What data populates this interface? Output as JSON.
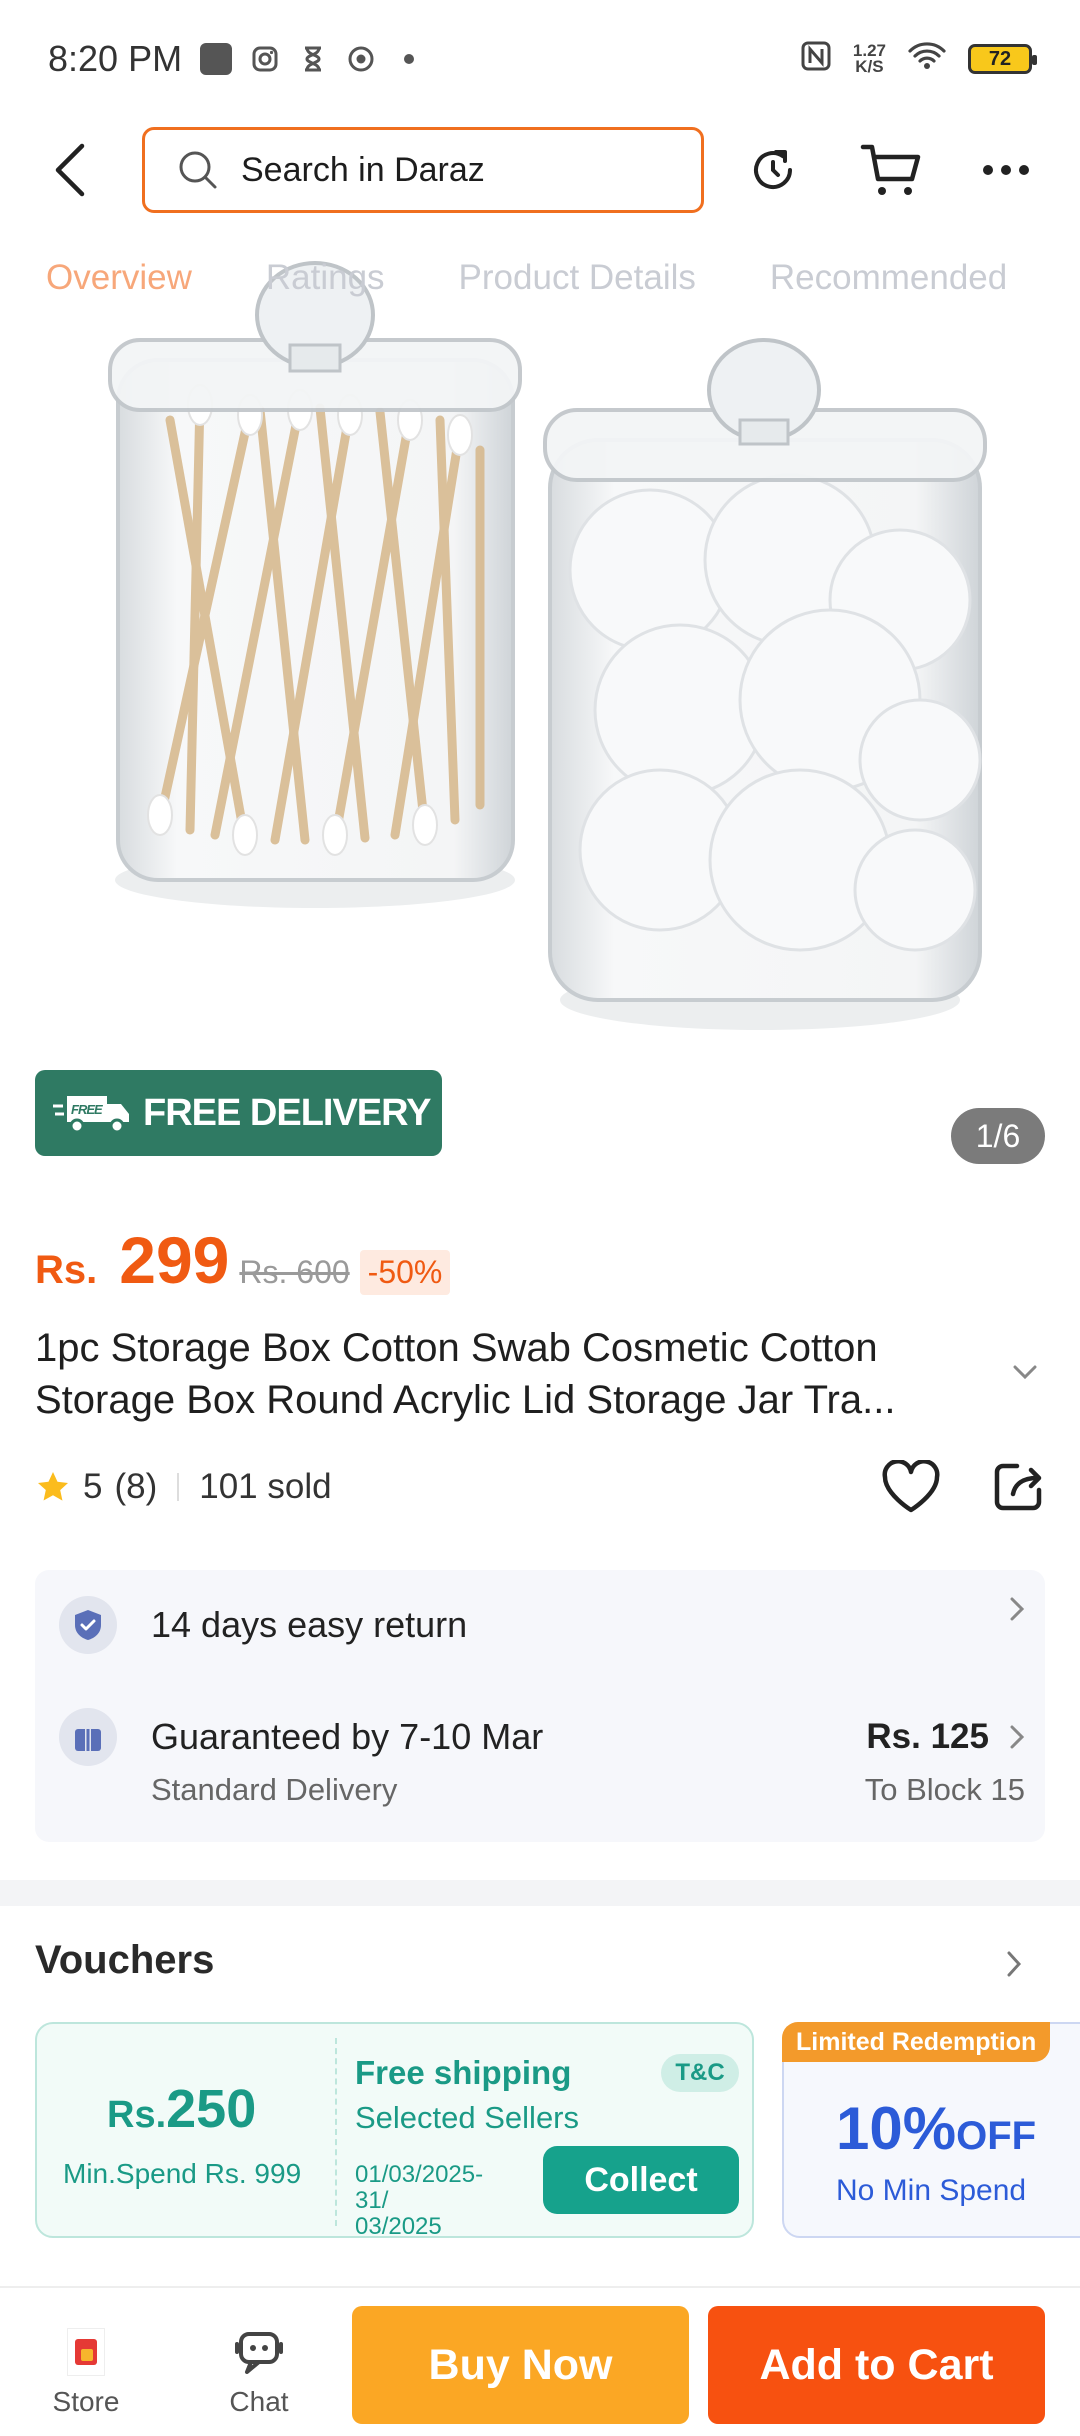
{
  "status_bar": {
    "time": "8:20 PM",
    "net_speed_value": "1.27",
    "net_speed_unit": "K/S",
    "battery": "72",
    "icons": [
      "app-square-icon",
      "instagram-icon",
      "hourglass-icon",
      "chrome-icon",
      "dot-icon",
      "nfc-icon",
      "wifi-icon",
      "battery-icon"
    ]
  },
  "header": {
    "search_placeholder": "Search in Daraz",
    "icons": [
      "back-icon",
      "search-icon",
      "refresh-icon",
      "cart-icon",
      "more-icon"
    ]
  },
  "tabs": [
    {
      "label": "Overview",
      "active": true
    },
    {
      "label": "Ratings",
      "active": false
    },
    {
      "label": "Product Details",
      "active": false
    },
    {
      "label": "Recommended",
      "active": false
    }
  ],
  "product": {
    "free_delivery_badge": "FREE DELIVERY",
    "truck_badge_text": "FREE",
    "image_counter": "1/6",
    "price_currency": "Rs.",
    "price": "299",
    "original_price": "Rs. 600",
    "discount": "-50%",
    "title_line1": "1pc Storage Box Cotton Swab Cosmetic Cotton",
    "title_line2": "Storage Box Round Acrylic Lid Storage Jar Tra...",
    "rating_value": "5",
    "rating_count": "(8)",
    "sold": "101 sold"
  },
  "services": {
    "return_text": "14 days easy return",
    "delivery_guarantee": "Guaranteed by 7-10 Mar",
    "delivery_type": "Standard Delivery",
    "delivery_fee": "Rs. 125",
    "delivery_location": "To Block 15"
  },
  "vouchers": {
    "section_title": "Vouchers",
    "voucher1": {
      "amount_prefix": "Rs.",
      "amount": "250",
      "min_spend": "Min.Spend Rs. 999",
      "title": "Free shipping",
      "subtitle": "Selected Sellers",
      "tnc": "T&C",
      "dates_line1": "01/03/2025-31/",
      "dates_line2": "03/2025",
      "collect_label": "Collect"
    },
    "voucher2": {
      "tag": "Limited Redemption",
      "percent": "10%",
      "off": "OFF",
      "condition": "No Min Spend"
    }
  },
  "bottom_bar": {
    "store_label": "Store",
    "chat_label": "Chat",
    "buy_now_label": "Buy Now",
    "add_to_cart_label": "Add to Cart"
  },
  "colors": {
    "accent_orange": "#f05a12",
    "buy_now": "#fba724",
    "add_to_cart": "#f75110",
    "free_delivery_green": "#2f7a63",
    "voucher_teal": "#1a9a86",
    "voucher_blue": "#2c5bd8"
  }
}
